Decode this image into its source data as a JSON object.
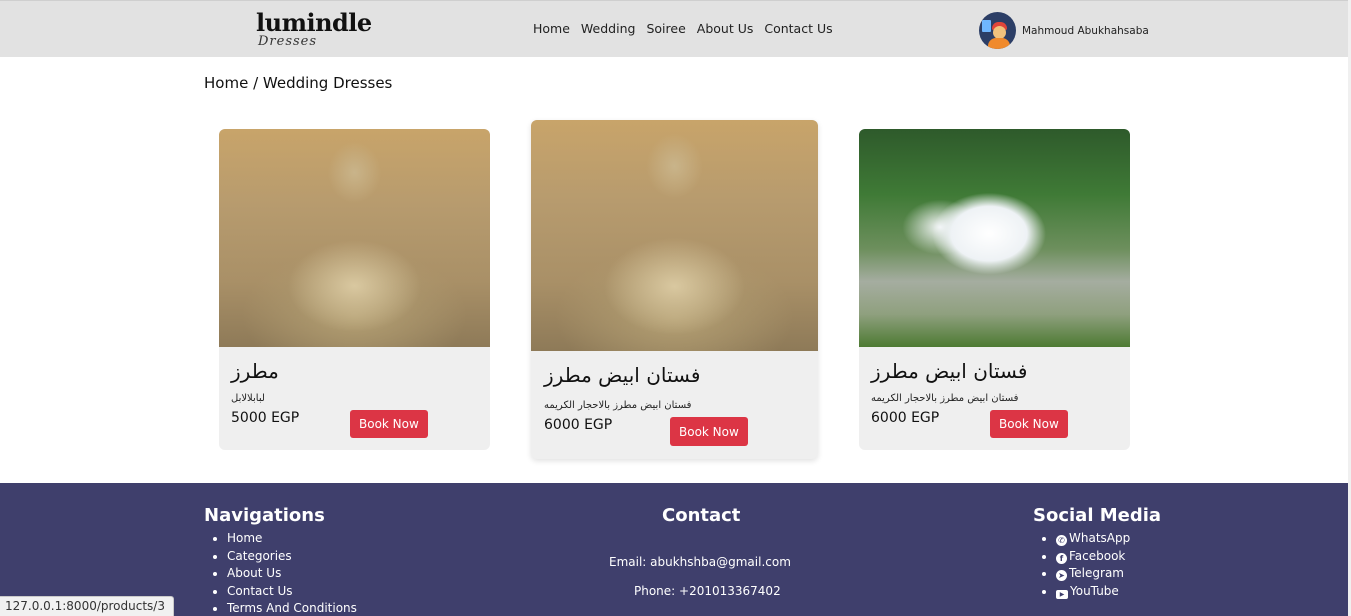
{
  "header": {
    "logo_top": "lumindle",
    "logo_bottom": "Dresses",
    "nav": [
      "Home",
      "Wedding",
      "Soiree",
      "About Us",
      "Contact Us"
    ],
    "user_name": "Mahmoud Abukhahsaba"
  },
  "breadcrumb": "Home / Wedding Dresses",
  "products": [
    {
      "title": "مطرز",
      "description": "لبابلالابل",
      "price": "5000 EGP",
      "button": "Book Now"
    },
    {
      "title": "فستان ابيض مطرز",
      "description": "فستان ابيض مطرز بالاحجار الكريمه",
      "price": "6000 EGP",
      "button": "Book Now"
    },
    {
      "title": "فستان ابيض مطرز",
      "description": "فستان ابيض مطرز بالاحجار الكريمه",
      "price": "6000 EGP",
      "button": "Book Now"
    }
  ],
  "footer": {
    "nav_heading": "Navigations",
    "nav_links": [
      "Home",
      "Categories",
      "About Us",
      "Contact Us",
      "Terms And Conditions"
    ],
    "contact_heading": "Contact",
    "email": "Email: abukhshba@gmail.com",
    "phone": "Phone: +201013367402",
    "social_heading": "Social Media",
    "social_links": [
      {
        "label": "WhatsApp",
        "icon": "whatsapp-icon"
      },
      {
        "label": "Facebook",
        "icon": "facebook-icon"
      },
      {
        "label": "Telegram",
        "icon": "telegram-icon"
      },
      {
        "label": "YouTube",
        "icon": "youtube-icon"
      }
    ]
  },
  "status_url": "127.0.0.1:8000/products/3",
  "colors": {
    "footer_bg": "#3f3f6c",
    "button": "#dc3545",
    "navbar_bg": "#e2e2e2"
  }
}
